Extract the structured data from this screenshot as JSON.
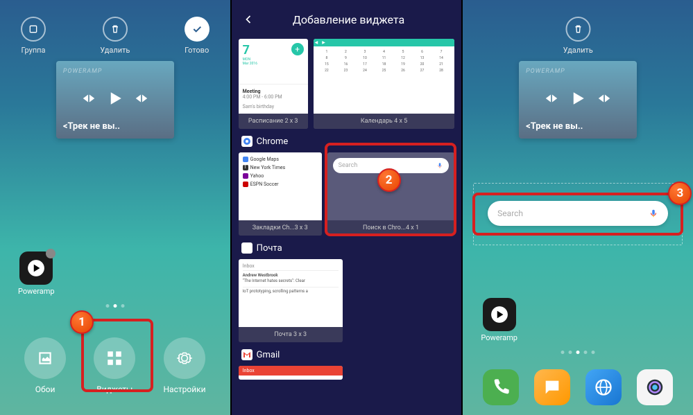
{
  "screen1": {
    "actions": {
      "group": "Группа",
      "delete": "Удалить",
      "done": "Готово"
    },
    "music": {
      "brand": "POWERAMP",
      "track": "<Трек не вы.."
    },
    "app": {
      "poweramp": "Poweramp"
    },
    "menu": {
      "wallpaper": "Обои",
      "widgets": "Виджеты",
      "settings": "Настройки"
    }
  },
  "screen2": {
    "title": "Добавление виджета",
    "schedule": {
      "day": "7",
      "dow": "MON",
      "date": "Mar 2016",
      "event": "Meeting",
      "time": "4:00 PM - 6:00 PM",
      "birthday": "Sam's birthday",
      "label": "Расписание     2 x 3"
    },
    "calendar": {
      "label": "Календарь      4 x 5"
    },
    "sections": {
      "chrome": "Chrome",
      "mail": "Почта",
      "gmail": "Gmail"
    },
    "bookmarks": {
      "items": [
        "Google Maps",
        "New York Times",
        "Yahoo",
        "ESPN Soccer"
      ],
      "label": "Закладки Ch...3 x 3"
    },
    "search": {
      "placeholder": "Search",
      "label": "Поиск в Chro...4 x 1"
    },
    "mail": {
      "inbox": "Inbox",
      "line1": "Andrew Westbrook",
      "line2": "\"The Internet hates secrets\": Clear",
      "line3": "IoT prototyping, scrolling patterns a",
      "label": "Почта               3 x 3"
    },
    "gmail": {
      "inbox": "Inbox"
    }
  },
  "screen3": {
    "delete": "Удалить",
    "music": {
      "brand": "POWERAMP",
      "track": "<Трек не вы.."
    },
    "search": {
      "placeholder": "Search"
    },
    "app": {
      "poweramp": "Poweramp"
    }
  },
  "annotations": {
    "1": "1",
    "2": "2",
    "3": "3"
  }
}
